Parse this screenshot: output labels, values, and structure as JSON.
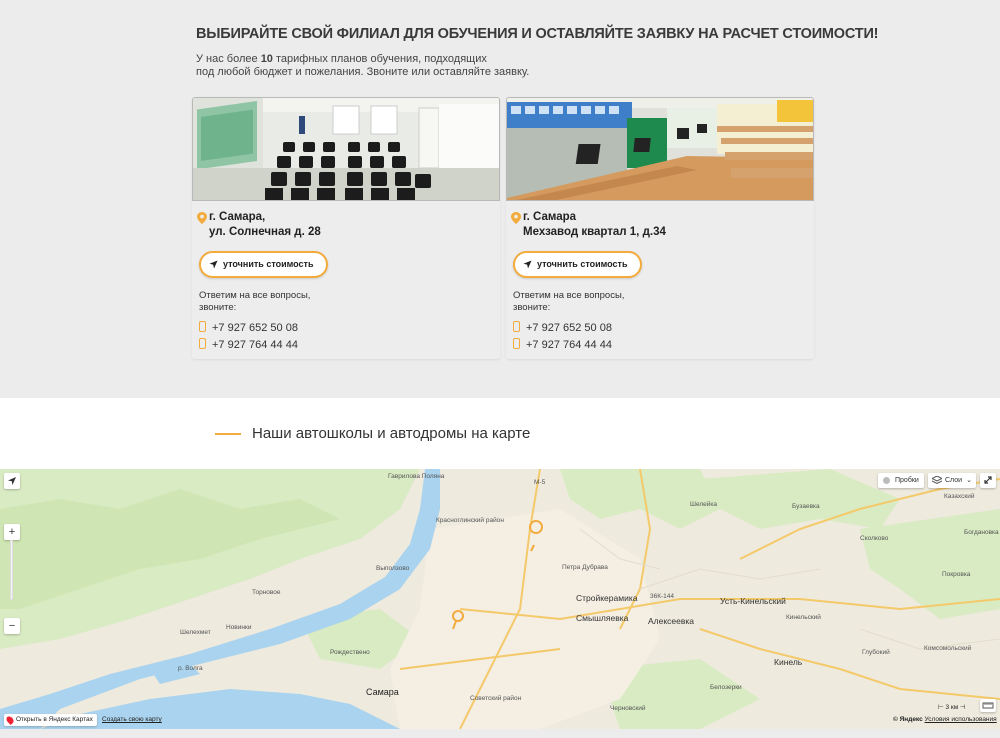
{
  "section": {
    "headline": "ВЫБИРАЙТЕ СВОЙ ФИЛИАЛ ДЛЯ ОБУЧЕНИЯ И ОСТАВЛЯЙТЕ ЗАЯВКУ НА РАСЧЕТ СТОИМОСТИ!",
    "intro_before": "У нас более ",
    "intro_count": "10",
    "intro_after": " тарифных планов обучения, подходящих",
    "intro_line2": "под любой бюджет и пожелания. Звоните или оставляйте заявку."
  },
  "branches": [
    {
      "city": "г. Самара,",
      "street": "ул. Солнечная д. 28",
      "button": "уточнить стоимость",
      "ask_line1": "Ответим на все вопросы,",
      "ask_line2": "звоните:",
      "phones": [
        "+7 927 652 50 08",
        "+7 927 764 44 44"
      ]
    },
    {
      "city": "г. Самара",
      "street": "Мехзавод квартал 1, д.34",
      "button": "уточнить стоимость",
      "ask_line1": "Ответим на все вопросы,",
      "ask_line2": "звоните:",
      "phones": [
        "+7 927 652 50 08",
        "+7 927 764 44 44"
      ]
    }
  ],
  "map_section": {
    "title": "Наши автошколы и автодромы на карте"
  },
  "map": {
    "controls": {
      "traffic": "Пробки",
      "layers": "Слои",
      "zoom_in": "+",
      "zoom_out": "−",
      "scale": "3 км"
    },
    "footer": {
      "open": "Открыть в Яндекс Картах",
      "create": "Создать свою карту",
      "copyright": "© Яндекс",
      "terms": "Условия использования"
    },
    "places": {
      "samara": "Самара",
      "stroykeramika": "Стройкерамика",
      "smyshlyaevka": "Смышляевка",
      "alekseevka": "Алексеевка",
      "ust_kinelsky": "Усть-Кинельский",
      "kinel": "Кинель",
      "vypolzovo": "Выползово",
      "tornovoe": "Торновое",
      "novinki": "Новинки",
      "shelehmet": "Шелехмет",
      "rozhdestveno": "Рождествено",
      "gavrilova_polyana": "Гаврилова Поляна",
      "petra_dubrava": "Петра Дубрава",
      "sheleyka": "Шелейка",
      "buzaevka": "Бузаевка",
      "kazakhsky": "Казахский",
      "bogdanovka": "Богдановка",
      "sokolovo": "Сколково",
      "pokrovka": "Покровка",
      "kinelsky": "Кинельский",
      "glubokiy": "Глубокий",
      "komsomolsky": "Комсомольский",
      "belozerki": "Белозерки",
      "chernovsky": "Черновский",
      "volga": "р. Волга",
      "krasnoglinsky": "Красноглинский район",
      "sovetsky": "Советский район",
      "road_m5": "М-5",
      "road_36k": "36К-144"
    }
  }
}
